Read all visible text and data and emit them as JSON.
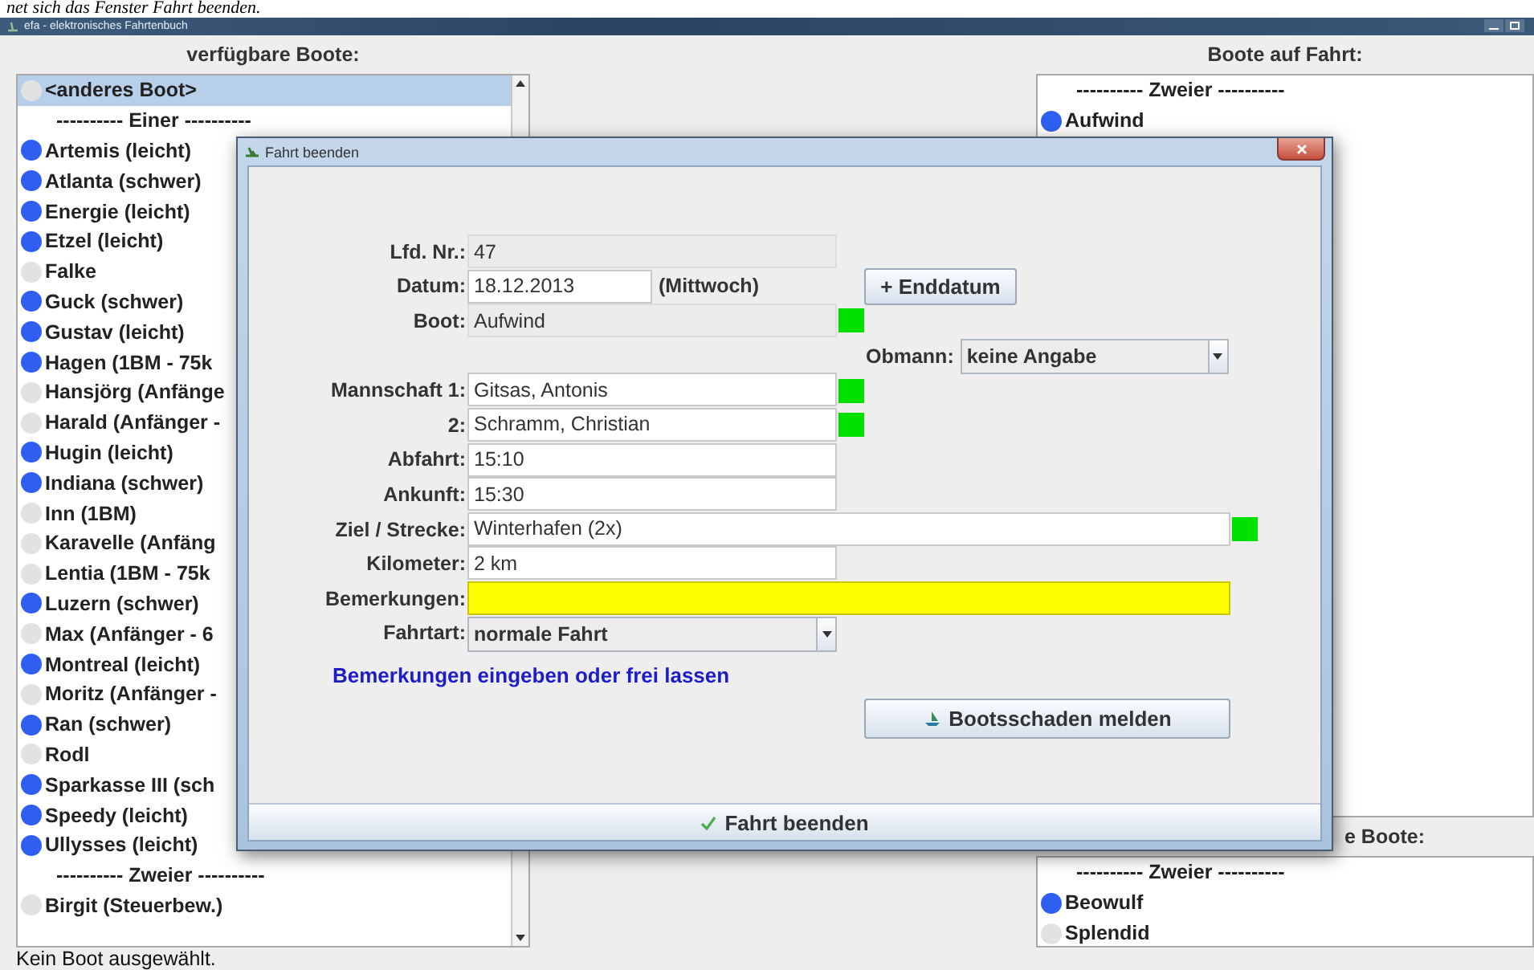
{
  "document_text": "net sich das Fenster *Fahrt beenden*.",
  "window": {
    "title": "efa - elektronisches Fahrtenbuch"
  },
  "available": {
    "heading": "verfügbare Boote:",
    "items": [
      {
        "kind": "boat",
        "label": "<anderes Boot>",
        "color": "#e2e2e2",
        "selected": true
      },
      {
        "kind": "separator",
        "label": "---------- Einer ----------",
        "selected": false
      },
      {
        "kind": "boat",
        "label": "Artemis (leicht)",
        "color": "#2f5ff0",
        "selected": false
      },
      {
        "kind": "boat",
        "label": "Atlanta (schwer)",
        "color": "#2f5ff0",
        "selected": false
      },
      {
        "kind": "boat",
        "label": "Energie (leicht)",
        "color": "#2f5ff0",
        "selected": false
      },
      {
        "kind": "boat",
        "label": "Etzel (leicht)",
        "color": "#2f5ff0",
        "selected": false
      },
      {
        "kind": "boat",
        "label": "Falke",
        "color": "#e2e2e2",
        "selected": false
      },
      {
        "kind": "boat",
        "label": "Guck (schwer)",
        "color": "#2f5ff0",
        "selected": false
      },
      {
        "kind": "boat",
        "label": "Gustav (leicht)",
        "color": "#2f5ff0",
        "selected": false
      },
      {
        "kind": "boat",
        "label": "Hagen (1BM - 75k",
        "color": "#2f5ff0",
        "selected": false
      },
      {
        "kind": "boat",
        "label": "Hansjörg (Anfänge",
        "color": "#e2e2e2",
        "selected": false
      },
      {
        "kind": "boat",
        "label": "Harald (Anfänger -",
        "color": "#e2e2e2",
        "selected": false
      },
      {
        "kind": "boat",
        "label": "Hugin (leicht)",
        "color": "#2f5ff0",
        "selected": false
      },
      {
        "kind": "boat",
        "label": "Indiana (schwer)",
        "color": "#2f5ff0",
        "selected": false
      },
      {
        "kind": "boat",
        "label": "Inn (1BM)",
        "color": "#e2e2e2",
        "selected": false
      },
      {
        "kind": "boat",
        "label": "Karavelle (Anfäng",
        "color": "#e2e2e2",
        "selected": false
      },
      {
        "kind": "boat",
        "label": "Lentia (1BM - 75k",
        "color": "#e2e2e2",
        "selected": false
      },
      {
        "kind": "boat",
        "label": "Luzern (schwer)",
        "color": "#2f5ff0",
        "selected": false
      },
      {
        "kind": "boat",
        "label": "Max (Anfänger - 6",
        "color": "#e2e2e2",
        "selected": false
      },
      {
        "kind": "boat",
        "label": "Montreal (leicht)",
        "color": "#2f5ff0",
        "selected": false
      },
      {
        "kind": "boat",
        "label": "Moritz (Anfänger -",
        "color": "#e2e2e2",
        "selected": false
      },
      {
        "kind": "boat",
        "label": "Ran (schwer)",
        "color": "#2f5ff0",
        "selected": false
      },
      {
        "kind": "boat",
        "label": "Rodl",
        "color": "#e2e2e2",
        "selected": false
      },
      {
        "kind": "boat",
        "label": "Sparkasse III (sch",
        "color": "#2f5ff0",
        "selected": false
      },
      {
        "kind": "boat",
        "label": "Speedy (leicht)",
        "color": "#2f5ff0",
        "selected": false
      },
      {
        "kind": "boat",
        "label": "Ullysses (leicht)",
        "color": "#2f5ff0",
        "selected": false
      },
      {
        "kind": "separator",
        "label": "---------- Zweier ----------",
        "selected": false
      },
      {
        "kind": "boat",
        "label": "Birgit (Steuerbew.)",
        "color": "#e2e2e2",
        "selected": false
      }
    ]
  },
  "status_bar": "Kein Boot ausgewählt.",
  "on_trip": {
    "heading": "Boote auf Fahrt:",
    "items": [
      {
        "kind": "separator",
        "label": "---------- Zweier ----------",
        "selected": false
      },
      {
        "kind": "boat",
        "label": "Aufwind",
        "color": "#2f5ff0",
        "selected": false
      }
    ]
  },
  "unavailable": {
    "heading": "e Boote:",
    "items": [
      {
        "kind": "separator",
        "label": "---------- Zweier ----------",
        "selected": false
      },
      {
        "kind": "boat",
        "label": "Beowulf",
        "color": "#2f5ff0",
        "selected": false
      },
      {
        "kind": "boat",
        "label": "Splendid",
        "color": "#e2e2e2",
        "selected": false
      }
    ]
  },
  "dialog": {
    "title": "Fahrt beenden",
    "lfd": {
      "label": "Lfd. Nr.:",
      "value": "47"
    },
    "datum": {
      "label": "Datum:",
      "value": "18.12.2013",
      "weekday": "(Mittwoch)"
    },
    "enddatum_button": "+ Enddatum",
    "boot": {
      "label": "Boot:",
      "value": "Aufwind",
      "ok": true
    },
    "obmann": {
      "label": "Obmann:",
      "value": "keine Angabe"
    },
    "crew": [
      {
        "label": "Mannschaft 1:",
        "value": "Gitsas, Antonis",
        "ok": true
      },
      {
        "label": "2:",
        "value": "Schramm, Christian",
        "ok": true
      }
    ],
    "abfahrt": {
      "label": "Abfahrt:",
      "value": "15:10"
    },
    "ankunft": {
      "label": "Ankunft:",
      "value": "15:30"
    },
    "ziel": {
      "label": "Ziel / Strecke:",
      "value": "Winterhafen (2x)",
      "ok": true
    },
    "kilometer": {
      "label": "Kilometer:",
      "value": "2 km"
    },
    "bemerkungen": {
      "label": "Bemerkungen:",
      "highlighted": true
    },
    "fahrtart": {
      "label": "Fahrtart:",
      "value": "normale Fahrt"
    },
    "hint": "Bemerkungen eingeben oder frei lassen",
    "damage_button": "Bootsschaden melden",
    "finish_button": "Fahrt beenden"
  }
}
